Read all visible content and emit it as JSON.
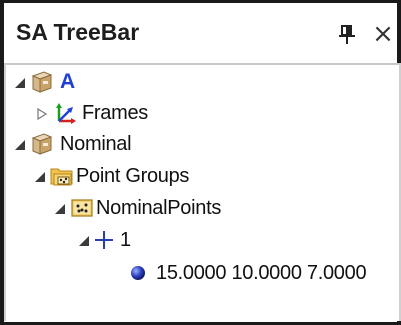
{
  "panel": {
    "title": "SA TreeBar",
    "pin_icon": "pin-icon",
    "close_glyph": "×"
  },
  "tree": {
    "root_a": {
      "label": "A",
      "expanded": true,
      "icon": "box-icon"
    },
    "frames": {
      "label": "Frames",
      "expanded": false,
      "icon": "frames-axes-icon"
    },
    "nominal": {
      "label": "Nominal",
      "expanded": true,
      "icon": "box-icon"
    },
    "point_groups": {
      "label": "Point Groups",
      "expanded": true,
      "icon": "folder-points-icon"
    },
    "nominal_points": {
      "label": "NominalPoints",
      "expanded": true,
      "icon": "point-group-icon"
    },
    "point_1": {
      "label": "1",
      "expanded": true,
      "icon": "crosshair-icon"
    },
    "coords": {
      "label": "15.0000 10.0000 7.0000",
      "icon": "sphere-point-icon"
    }
  },
  "colors": {
    "label_a_color": "#1f3fd8",
    "frame_border": "#1a1a1a"
  }
}
